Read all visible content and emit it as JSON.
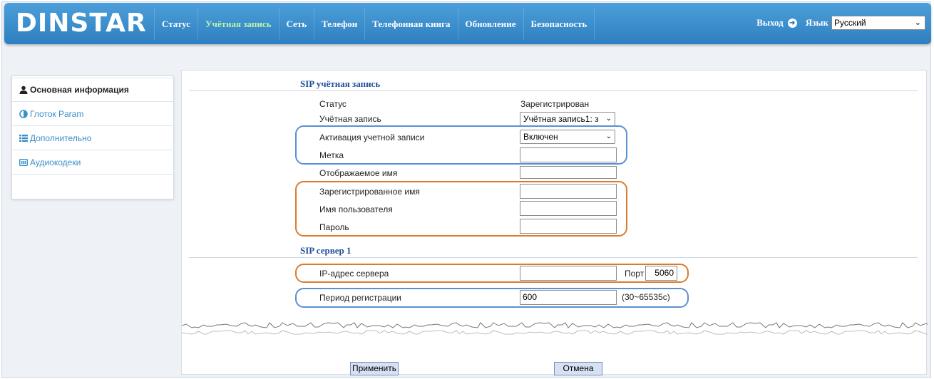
{
  "header": {
    "logo": "DINSTAR",
    "nav": [
      "Статус",
      "Учётная запись",
      "Сеть",
      "Телефон",
      "Телефонная книга",
      "Обновление",
      "Безопасность"
    ],
    "active_nav": "Учётная запись",
    "logout": "Выход",
    "language_label": "Язык",
    "language_value": "Русский"
  },
  "sidebar": {
    "items": [
      {
        "label": "Основная информация",
        "icon": "user-icon"
      },
      {
        "label": "Глоток Param",
        "icon": "half-circle-icon"
      },
      {
        "label": "Дополнительно",
        "icon": "list-icon"
      },
      {
        "label": "Аудиокодеки",
        "icon": "codec-icon"
      }
    ]
  },
  "sip_account": {
    "title": "SIP учётная запись",
    "status_label": "Статус",
    "status_value": "Зарегистрирован",
    "account_label": "Учётная запись",
    "account_value": "Учётная запись1: з",
    "activation_label": "Активация учетной записи",
    "activation_value": "Включен",
    "tag_label": "Метка",
    "tag_value": "",
    "display_name_label": "Отображаемое имя",
    "display_name_value": "",
    "registered_name_label": "Зарегистрированное имя",
    "registered_name_value": "",
    "username_label": "Имя пользователя",
    "username_value": "",
    "password_label": "Пароль",
    "password_value": ""
  },
  "sip_server": {
    "title": "SIP сервер 1",
    "ip_label": "IP-адрес сервера",
    "ip_value": "",
    "port_label": "Порт",
    "port_value": "5060",
    "period_label": "Период регистрации",
    "period_value": "600",
    "period_range": "(30~65535c)"
  },
  "actions": {
    "apply": "Применить",
    "cancel": "Отмена"
  },
  "colors": {
    "header_blue": "#2f7fc0",
    "active_nav": "#bff5a8",
    "link_blue": "#3a8fc9",
    "section_title": "#1f4e9c",
    "highlight_blue": "#5b8fd0",
    "highlight_orange": "#dd7a2a"
  }
}
